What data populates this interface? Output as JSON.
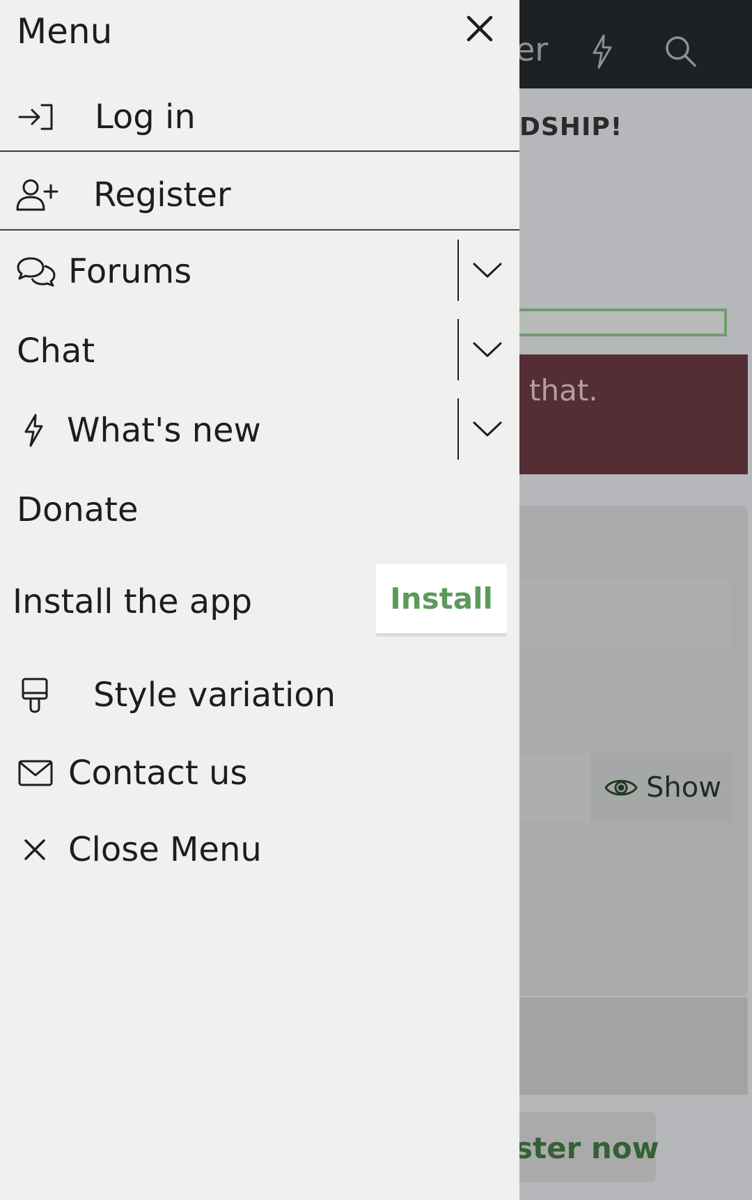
{
  "background": {
    "header_text": "er",
    "banner_text": "DSHIP!",
    "error_text": "that.",
    "show_label": "Show",
    "register_label": "ster now"
  },
  "menu": {
    "title": "Menu",
    "items": {
      "login": "Log in",
      "register": "Register",
      "forums": "Forums",
      "chat": "Chat",
      "whats_new": "What's new",
      "donate": "Donate",
      "install_app": "Install the app",
      "install_button": "Install",
      "style_variation": "Style variation",
      "contact_us": "Contact us",
      "close_menu": "Close Menu"
    }
  },
  "icons": {
    "close": "close-icon",
    "login": "login-icon",
    "register": "user-plus-icon",
    "forums": "comments-icon",
    "whats_new": "bolt-icon",
    "style": "paint-brush-icon",
    "contact": "envelope-icon",
    "expand": "chevron-down-icon",
    "search": "search-icon",
    "eye": "eye-icon"
  },
  "colors": {
    "menu_bg": "#f0f0f0",
    "accent_green": "#5b9a5b",
    "header_dark": "#1d2124",
    "error_bg": "#542d35"
  }
}
